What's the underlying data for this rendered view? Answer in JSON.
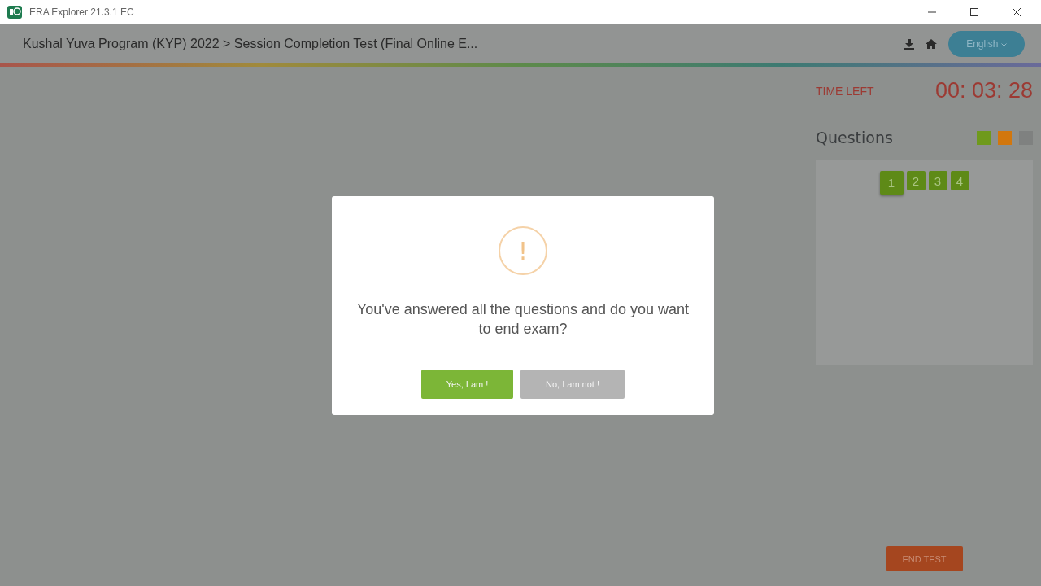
{
  "window": {
    "title": "ERA Explorer 21.3.1 EC"
  },
  "header": {
    "breadcrumb": "Kushal Yuva Program (KYP) 2022 > Session Completion Test (Final Online E...",
    "language": "English"
  },
  "timer": {
    "label": "TIME LEFT",
    "value": "00: 03: 28"
  },
  "questions": {
    "title": "Questions",
    "legend": [
      {
        "color": "#6f9a1c"
      },
      {
        "color": "#d2770e"
      },
      {
        "color": "#7f8180"
      }
    ],
    "items": [
      {
        "label": "1",
        "selected": true
      },
      {
        "label": "2",
        "selected": false
      },
      {
        "label": "3",
        "selected": false
      },
      {
        "label": "4",
        "selected": false
      }
    ]
  },
  "end_button": "END TEST",
  "dialog": {
    "icon_text": "!",
    "message": "You've answered all the questions and do you want to end exam?",
    "buttons": [
      {
        "label": "Yes, I am !",
        "kind": "confirm"
      },
      {
        "label": "No, I am not !",
        "kind": "cancel"
      }
    ]
  }
}
